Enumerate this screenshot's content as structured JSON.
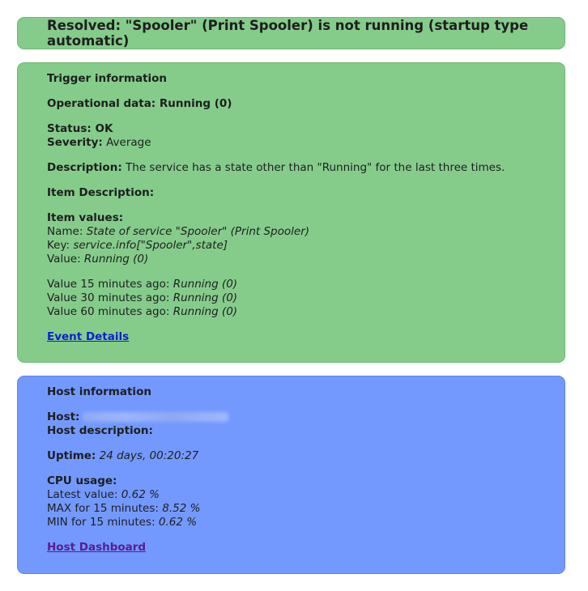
{
  "header": {
    "title": "Resolved: \"Spooler\" (Print Spooler) is not running (startup type automatic)"
  },
  "trigger": {
    "section_title": "Trigger information",
    "operational_label": "Operational data:",
    "operational_value": "Running (0)",
    "status_label": "Status:",
    "status_value": "OK",
    "severity_label": "Severity:",
    "severity_value": "Average",
    "description_label": "Description:",
    "description_value": "The service has a state other than \"Running\" for the last three times.",
    "item_description_label": "Item Description:",
    "item_values_label": "Item values:",
    "name_label": "Name:",
    "name_value": "State of service \"Spooler\" (Print Spooler)",
    "key_label": "Key:",
    "key_value": "service.info[\"Spooler\",state]",
    "value_label": "Value:",
    "value_value": "Running (0)",
    "history": [
      {
        "label": "Value 15 minutes ago:",
        "value": "Running (0)"
      },
      {
        "label": "Value 30 minutes ago:",
        "value": "Running (0)"
      },
      {
        "label": "Value 60 minutes ago:",
        "value": "Running (0)"
      }
    ],
    "event_link": "Event Details"
  },
  "host": {
    "section_title": "Host information",
    "host_label": "Host:",
    "host_description_label": "Host description:",
    "uptime_label": "Uptime:",
    "uptime_value": "24 days, 00:20:27",
    "cpu_label": "CPU usage:",
    "latest_label": "Latest value:",
    "latest_value": "0.62 %",
    "max_label": "MAX for 15 minutes:",
    "max_value": "8.52 %",
    "min_label": "MIN for 15 minutes:",
    "min_value": "0.62 %",
    "dashboard_link": "Host Dashboard"
  },
  "colors": {
    "resolved_green": "#85cc8b",
    "host_blue": "#7399ff",
    "link_blue": "#0b1fd1",
    "link_visited": "#5a1c8f"
  }
}
